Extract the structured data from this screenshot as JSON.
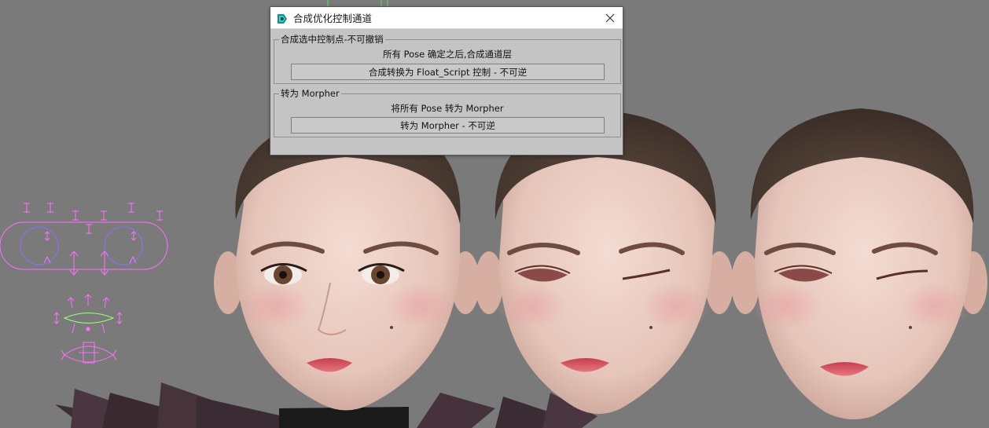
{
  "dialog": {
    "title": "合成优化控制通道",
    "app_icon": "3ds-max-icon",
    "close_icon": "close-icon",
    "groups": [
      {
        "legend": "合成选中控制点-不可撤销",
        "description": "所有 Pose 确定之后,合成通道层",
        "button_label": "合成转换为 Float_Script 控制 - 不可逆"
      },
      {
        "legend": "转为 Morpher",
        "description": "将所有 Pose 转为 Morpher",
        "button_label": "转为 Morpher - 不可逆"
      }
    ]
  },
  "viewport": {
    "background_color": "#7a7a7a",
    "rig_color": "#ff70ff",
    "rig_accent_color": "#a0ff80",
    "heads": [
      "head-neutral",
      "head-left-blink",
      "head-left-blink-alt"
    ]
  }
}
